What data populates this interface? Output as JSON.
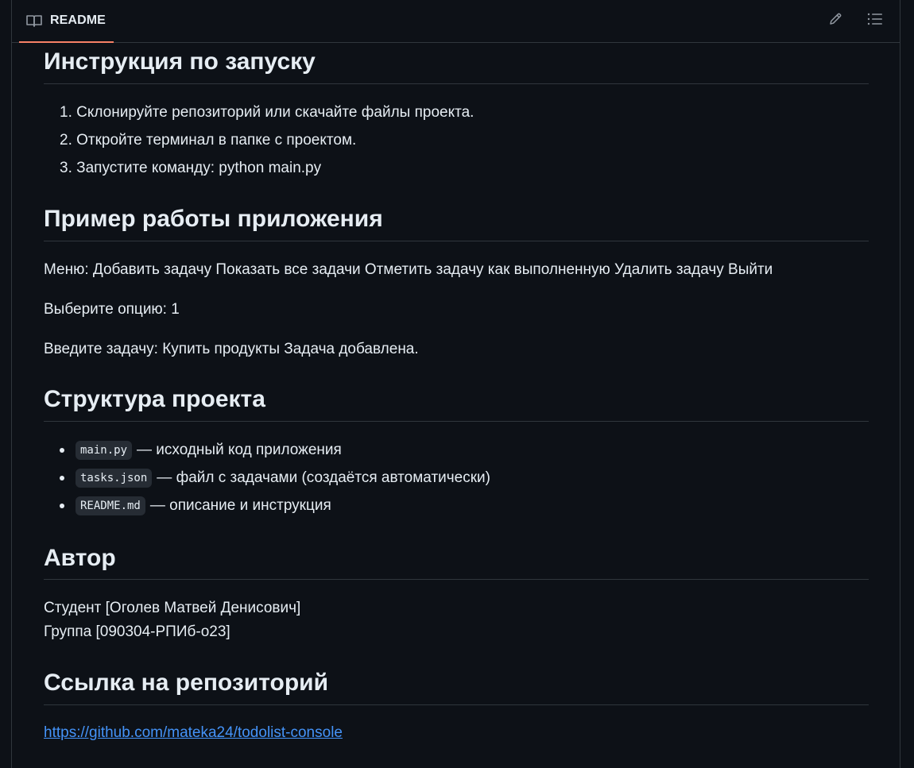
{
  "tab": {
    "label": "README",
    "icon": "book-icon"
  },
  "toolbar": {
    "edit_icon": "pencil-icon",
    "outline_icon": "list-unordered-icon"
  },
  "colors": {
    "accent_underline": "#f78166",
    "link": "#4493f8",
    "bg": "#0d1117",
    "border": "#30363d"
  },
  "sections": {
    "run": {
      "title": "Инструкция по запуску",
      "steps": [
        "1. Склонируйте репозиторий или скачайте файлы проекта.",
        "2. Откройте терминал в папке с проектом.",
        "3. Запустите команду: python main.py"
      ]
    },
    "example": {
      "title": "Пример работы приложения",
      "lines": [
        "Меню: Добавить задачу Показать все задачи Отметить задачу как выполненную Удалить задачу Выйти",
        "Выберите опцию: 1",
        "Введите задачу: Купить продукты Задача добавлена."
      ]
    },
    "structure": {
      "title": "Структура проекта",
      "items": [
        {
          "code": "main.py",
          "text": "— исходный код приложения"
        },
        {
          "code": "tasks.json",
          "text": "— файл с задачами (создаётся автоматически)"
        },
        {
          "code": "README.md",
          "text": "— описание и инструкция"
        }
      ]
    },
    "author": {
      "title": "Автор",
      "line1": "Студент [Оголев Матвей Денисович]",
      "line2": "Группа [090304-РПИб-о23]"
    },
    "repo": {
      "title": "Ссылка на репозиторий",
      "url": "https://github.com/mateka24/todolist-console"
    }
  }
}
